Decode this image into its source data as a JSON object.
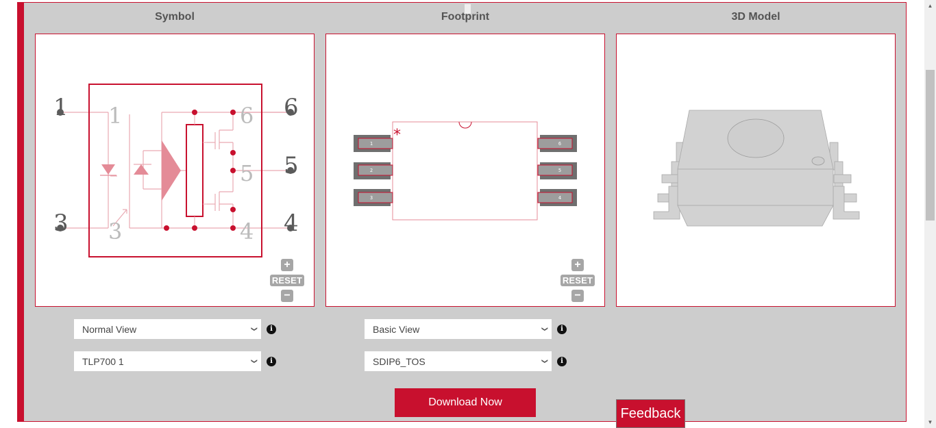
{
  "columns": {
    "symbol": {
      "title": "Symbol"
    },
    "footprint": {
      "title": "Footprint"
    },
    "model3d": {
      "title": "3D Model"
    }
  },
  "symbol_view": {
    "outer_pins": [
      "1",
      "3",
      "6",
      "5",
      "4"
    ],
    "inner_pins": [
      "1",
      "3",
      "6",
      "5",
      "4"
    ]
  },
  "footprint_view": {
    "pads_left": [
      "1",
      "2",
      "3"
    ],
    "pads_right": [
      "6",
      "5",
      "4"
    ],
    "pin1_marker": "*"
  },
  "zoom_controls": {
    "zoom_in": "+",
    "reset": "RESET",
    "zoom_out": "−"
  },
  "selects": {
    "symbol_view_mode": {
      "value": "Normal View"
    },
    "symbol_part": {
      "value": "TLP700 1"
    },
    "footprint_view_mode": {
      "value": "Basic View"
    },
    "footprint_package": {
      "value": "SDIP6_TOS"
    }
  },
  "info_glyph": "i",
  "chevron_glyph": "⌄",
  "buttons": {
    "download": "Download Now",
    "feedback": "Feedback"
  },
  "scrollbar": {
    "up_glyph": "▲",
    "down_glyph": "▼"
  },
  "colors": {
    "accent": "#c8102e",
    "panel_bg": "#cdcdcd",
    "pad_gray": "#6f6f6f",
    "schematic_pink": "#e48b97"
  }
}
